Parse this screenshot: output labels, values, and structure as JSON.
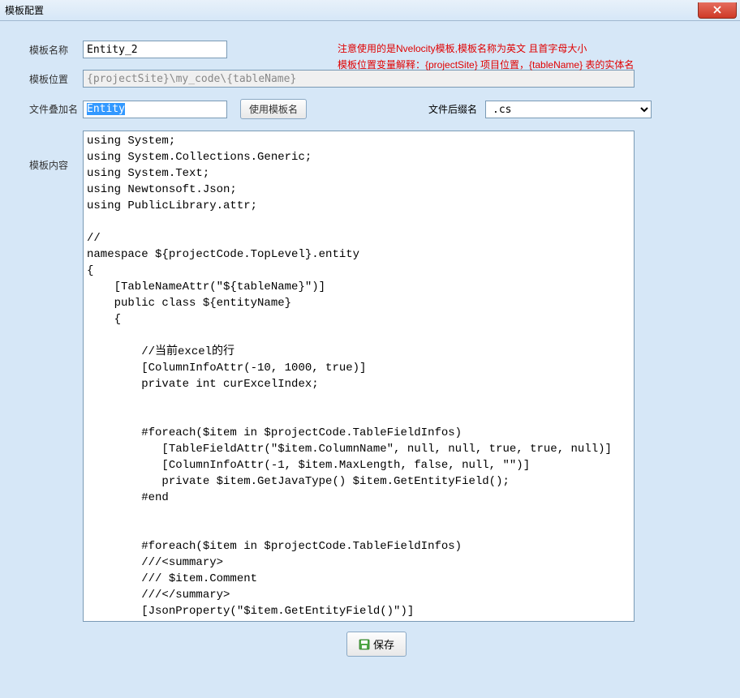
{
  "window": {
    "title": "模板配置"
  },
  "labels": {
    "template_name": "模板名称",
    "template_path": "模板位置",
    "file_overlay_name": "文件叠加名",
    "file_ext": "文件后缀名",
    "template_content": "模板内容"
  },
  "fields": {
    "template_name_value": "Entity_2",
    "template_path_value": "{projectSite}\\my_code\\{tableName}",
    "file_overlay_value": "Entity",
    "file_ext_value": ".cs"
  },
  "buttons": {
    "use_template_name": "使用模板名",
    "save": "保存"
  },
  "notice": {
    "line1": "注意使用的是Nvelocity模板,模板名称为英文 且首字母大小",
    "line2": "模板位置变量解释：{projectSite} 项目位置，{tableName} 表的实体名"
  },
  "code": "using System;\nusing System.Collections.Generic;\nusing System.Text;\nusing Newtonsoft.Json;\nusing PublicLibrary.attr;\n\n//\nnamespace ${projectCode.TopLevel}.entity\n{\n    [TableNameAttr(\"${tableName}\")]\n    public class ${entityName}\n    {\n\n        //当前excel的行\n        [ColumnInfoAttr(-10, 1000, true)]\n        private int curExcelIndex;\n\n\n        #foreach($item in $projectCode.TableFieldInfos)\n           [TableFieldAttr(\"$item.ColumnName\", null, null, true, true, null)]\n           [ColumnInfoAttr(-1, $item.MaxLength, false, null, \"\")]\n           private $item.GetJavaType() $item.GetEntityField();\n        #end\n\n\n        #foreach($item in $projectCode.TableFieldInfos)\n        ///<summary>\n        /// $item.Comment\n        ///</summary>\n        [JsonProperty(\"$item.GetEntityField()\")]"
}
